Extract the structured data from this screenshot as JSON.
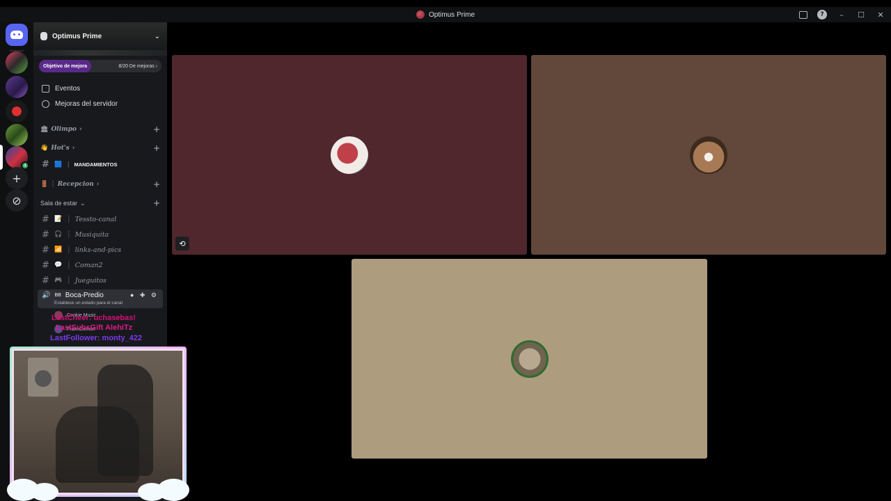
{
  "window": {
    "title": "Optimus Prime"
  },
  "server": {
    "name": "Optimus Prime",
    "boost_goal_label": "Objetivo de mejora",
    "boost_progress": "8/20 De mejoras",
    "boost_progress_value": 0.4
  },
  "nav": {
    "events": "Eventos",
    "server_boosts": "Mejoras del servidor"
  },
  "categories": {
    "olimpo": "Olimpo",
    "hots": "Hot's",
    "recepcion": "Recepcion",
    "sala": "Sala de estar"
  },
  "channels": {
    "mandamientos": "MANDAMIENTOS",
    "tessto": "Tessto-canal",
    "musiquita": "Musiquita",
    "links": "links-and-pics",
    "coman2": "Coman2",
    "jueguitos": "Jueguitos"
  },
  "voice": {
    "prefix": "BB",
    "name": "Boca-Predio",
    "status_placeholder": "Establece un estado para el canal",
    "members": [
      "Cookie Music",
      "FrannDemon"
    ]
  },
  "overlay": {
    "last_cheer": "LastCheer: uchasebas!",
    "last_sub_gift": "LastSubsGift AlehiTz",
    "last_follower": "LastFollower: monty_422"
  },
  "icons": {
    "home": "discord-home-icon",
    "add": "add-server-icon",
    "discover": "discover-icon"
  },
  "colors": {
    "tile1": "#4f272d",
    "tile2": "#62473b",
    "tile3": "#ae9c7e",
    "accent": "#5865f2"
  }
}
